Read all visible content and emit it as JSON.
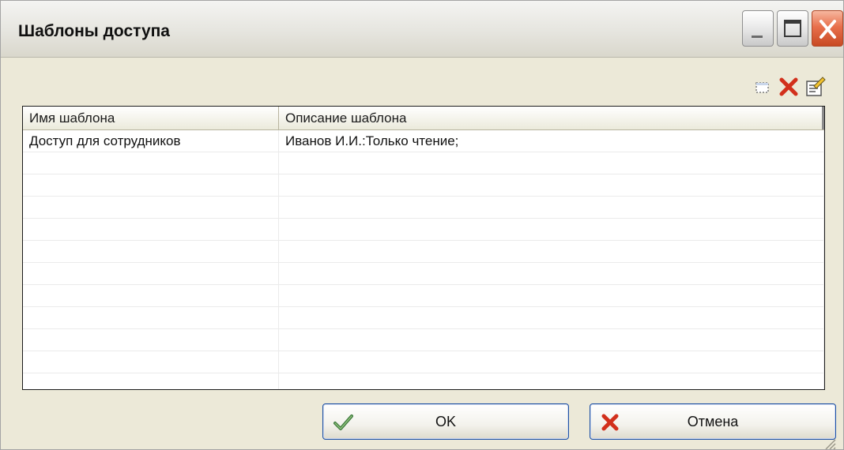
{
  "window": {
    "title": "Шаблоны доступа",
    "accent_close": "#e8704c"
  },
  "toolbar": {
    "icons": [
      "new-item-icon",
      "delete-icon",
      "properties-icon"
    ]
  },
  "table": {
    "columns": [
      "Имя шаблона",
      "Описание шаблона"
    ],
    "rows": [
      {
        "name": "Доступ для сотрудников",
        "description": "Иванов И.И.:Только чтение;"
      }
    ]
  },
  "buttons": {
    "ok_label": "OK",
    "cancel_label": "Отмена"
  }
}
